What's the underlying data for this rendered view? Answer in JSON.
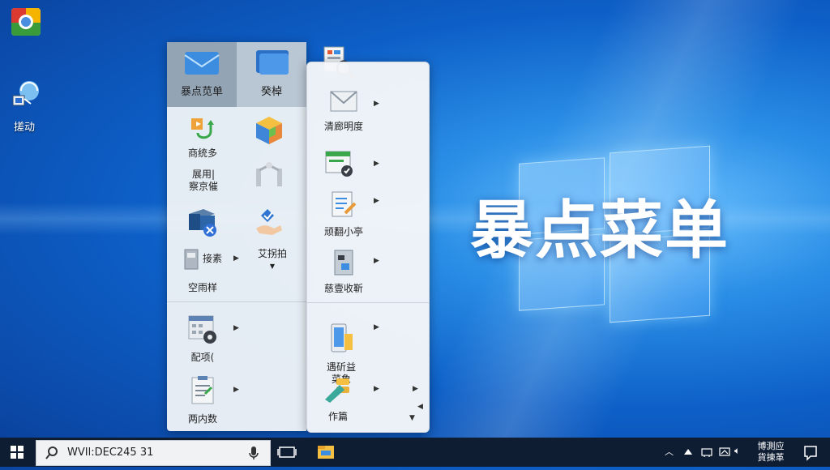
{
  "desktop": {
    "hero_text": "暴点菜单",
    "icons": [
      {
        "label": "",
        "icon": "chrome-icon"
      },
      {
        "label": "搓动",
        "icon": "network-icon"
      }
    ]
  },
  "start_menu": {
    "tiles": [
      {
        "label": "暴点苋单",
        "icon": "mail-tile-icon",
        "active": true
      },
      {
        "label": "癸棹",
        "icon": "folder-tile-icon",
        "active": false
      }
    ],
    "left_items": [
      {
        "label": "商统多",
        "icon": "package-arrow-icon"
      },
      {
        "label": "",
        "icon": "cube-icon"
      },
      {
        "label": "展用|\n察京催",
        "icon": ""
      },
      {
        "label": "",
        "icon": "network-nodes-icon"
      },
      {
        "label": "",
        "icon": "blue-box-x-icon"
      },
      {
        "label": "",
        "icon": "handshake-icon"
      },
      {
        "label": "接素",
        "icon": "tool-page-icon"
      },
      {
        "label": "艾拐拍",
        "icon": ""
      },
      {
        "label": "空雨样",
        "icon": ""
      },
      {
        "label": "配项(",
        "icon": "calendar-gear-icon"
      },
      {
        "label": "两内数",
        "icon": "clipboard-icon"
      }
    ],
    "right_items": [
      {
        "label": "",
        "icon": "search-document-icon"
      },
      {
        "label": "清廊明度",
        "icon": "mail-icon"
      },
      {
        "label": "",
        "icon": "window-check-icon"
      },
      {
        "label": "顽翻小亭",
        "icon": "document-edit-icon"
      },
      {
        "label": "慈壹收靳",
        "icon": "recycle-bin-icon"
      },
      {
        "label": "遇斫益\n菜象",
        "icon": "phone-doc-icon"
      },
      {
        "label": "作篇",
        "icon": "marker-icon"
      }
    ]
  },
  "taskbar": {
    "search_text": "WVIl:DEC245 31",
    "clock_line1": "博測应",
    "clock_line2": "貨揀革",
    "colors": {
      "bar": "#0f1d33",
      "accent": "#0d5fc7"
    }
  }
}
